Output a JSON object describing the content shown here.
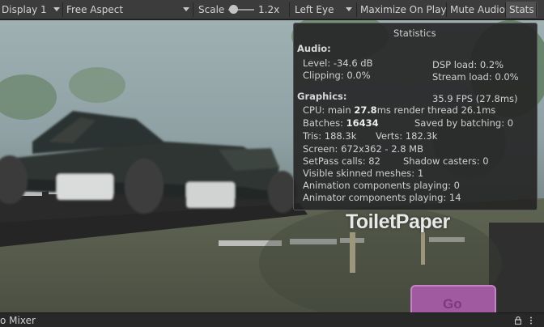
{
  "toolbar": {
    "display": "Display 1",
    "aspect": "Free Aspect",
    "scale_label": "Scale",
    "scale_value": "1.2x",
    "eye": "Left Eye",
    "maximize": "Maximize On Play",
    "mute": "Mute Audio",
    "stats": "Stats",
    "scale_level": 0.15
  },
  "scene": {
    "billboard_text": "ToiletPaper",
    "go_button": "Go"
  },
  "stats": {
    "title": "Statistics",
    "audio_header": "Audio:",
    "level": "Level: -34.6 dB",
    "dsp_load": "DSP load: 0.2%",
    "clipping": "Clipping: 0.0%",
    "stream_load": "Stream load: 0.0%",
    "graphics_header": "Graphics:",
    "fps": "35.9 FPS (27.8ms)",
    "cpu_prefix": "CPU: main ",
    "cpu_main": "27.8",
    "cpu_suffix": "ms  render thread 26.1ms",
    "batches_prefix": "Batches: ",
    "batches": "16434",
    "saved_by_batching": "Saved by batching: 0",
    "tris": "Tris: 188.3k",
    "verts": "Verts: 182.3k",
    "screen": "Screen: 672x362 - 2.8 MB",
    "setpass": "SetPass calls: 82",
    "shadow_casters": "Shadow casters: 0",
    "skinned": "Visible skinned meshes: 1",
    "animation": "Animation components playing: 0",
    "animator": "Animator components playing: 14"
  },
  "bottom": {
    "tab_label": "o Mixer"
  },
  "colors": {
    "toolbar_bg": "#3c3c3c",
    "panel_bg": "#242424",
    "go_button": "#a05aa0"
  }
}
